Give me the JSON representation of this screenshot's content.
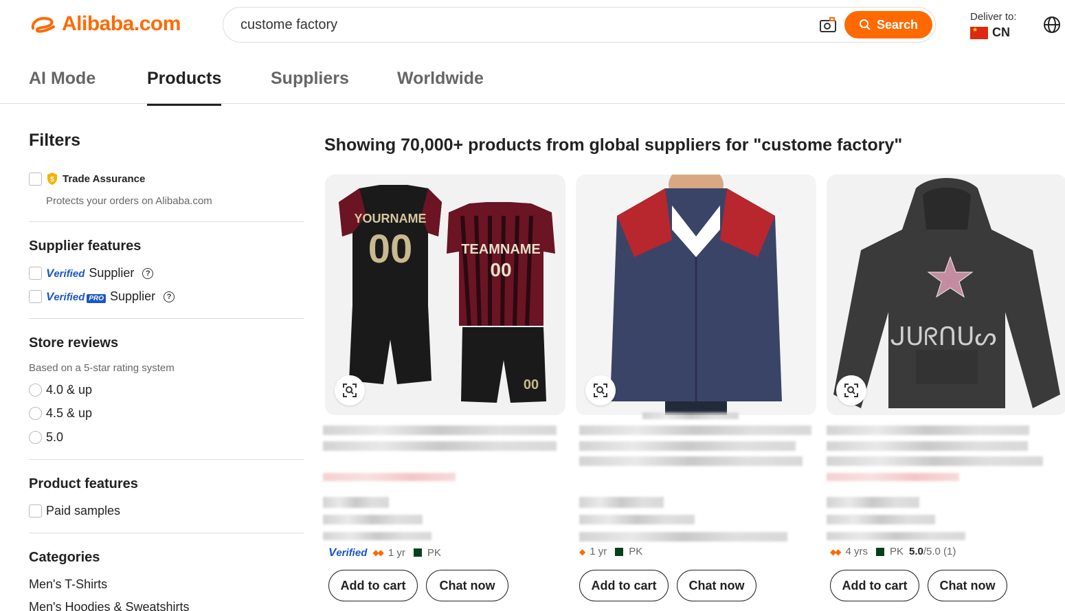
{
  "header": {
    "logo_text": "Alibaba.com",
    "search_value": "custome factory",
    "search_button": "Search",
    "deliver_label": "Deliver to:",
    "deliver_code": "CN"
  },
  "tabs": [
    {
      "label": "AI Mode"
    },
    {
      "label": "Products"
    },
    {
      "label": "Suppliers"
    },
    {
      "label": "Worldwide"
    }
  ],
  "sidebar": {
    "title": "Filters",
    "trade_assurance": "Trade Assurance",
    "trade_assurance_note": "Protects your orders on Alibaba.com",
    "supplier_features_title": "Supplier features",
    "verified_word": "erified",
    "verified_v": "V",
    "supplier_word": "Supplier",
    "pro_label": "PRO",
    "store_reviews_title": "Store reviews",
    "store_reviews_note": "Based on a 5-star rating system",
    "ratings": [
      "4.0 & up",
      "4.5 & up",
      "5.0"
    ],
    "product_features_title": "Product features",
    "paid_samples": "Paid samples",
    "categories_title": "Categories",
    "categories": [
      "Men's T-Shirts",
      "Men's Hoodies & Sweatshirts"
    ]
  },
  "main": {
    "results_title": "Showing 70,000+ products from global suppliers for \"custome factory\"",
    "cards": [
      {
        "image": "soccer-jersey-image",
        "years": "1 yr",
        "country": "PK",
        "rating": "",
        "rating_suffix": "",
        "verified": true
      },
      {
        "image": "jacket-image",
        "years": "1 yr",
        "country": "PK",
        "rating": "",
        "rating_suffix": "",
        "verified": false
      },
      {
        "image": "hoodie-image",
        "years": "4 yrs",
        "country": "PK",
        "rating": "5.0",
        "rating_suffix": "/5.0 (1)",
        "verified": false
      }
    ],
    "add_to_cart": "Add to cart",
    "chat_now": "Chat now"
  },
  "colors": {
    "brand": "#ff6a00",
    "verified_blue": "#1a56c4"
  }
}
